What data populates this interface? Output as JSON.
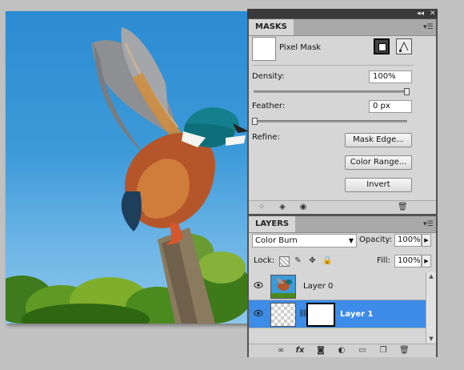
{
  "colors": {
    "accent_selected": "#3c8ce8",
    "panel_bg": "#d6d6d6",
    "panel_frame": "#535353"
  },
  "window": {
    "collapse_icon": "double-chevron-left-icon",
    "close_icon": "close-icon"
  },
  "masks": {
    "tab_label": "MASKS",
    "pixel_mask_label": "Pixel Mask",
    "density": {
      "label": "Density:",
      "value": "100%",
      "slider_fraction": 1.0
    },
    "feather": {
      "label": "Feather:",
      "value": "0 px",
      "slider_fraction": 0.0
    },
    "refine_label": "Refine:",
    "buttons": {
      "mask_edge": "Mask Edge...",
      "color_range": "Color Range...",
      "invert": "Invert"
    },
    "footer_icons": [
      "load-selection-icon",
      "apply-mask-icon",
      "visibility-eye-icon",
      "trash-icon"
    ]
  },
  "layers": {
    "tab_label": "LAYERS",
    "blend_mode": "Color Burn",
    "opacity": {
      "label": "Opacity:",
      "value": "100%"
    },
    "fill": {
      "label": "Fill:",
      "value": "100%"
    },
    "lock_label": "Lock:",
    "lock_icons": [
      "lock-transparent-icon",
      "lock-pixels-icon",
      "lock-position-icon",
      "lock-all-icon"
    ],
    "items": [
      {
        "name": "Layer 0",
        "selected": false,
        "visible": true
      },
      {
        "name": "Layer 1",
        "selected": true,
        "visible": true
      }
    ],
    "footer_icons": [
      "link-icon",
      "fx-icon",
      "add-mask-icon",
      "adjustment-layer-icon",
      "new-group-icon",
      "new-layer-icon",
      "trash-icon"
    ],
    "footer_fx_label": "fx"
  }
}
